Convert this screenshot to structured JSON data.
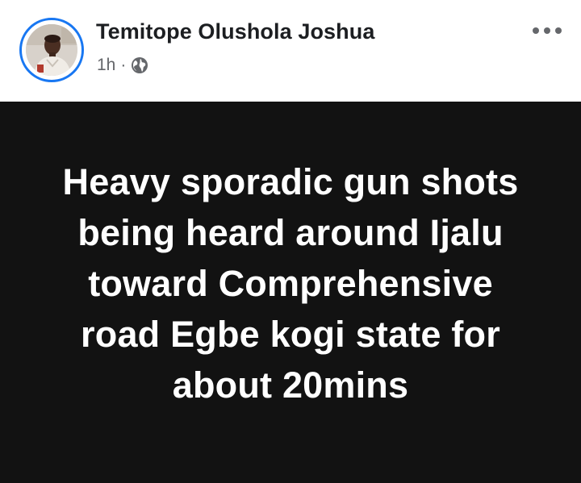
{
  "post": {
    "author": {
      "name": "Temitope Olushola Joshua",
      "avatar_icon": "profile-photo",
      "ring_color": "#1877f2"
    },
    "meta": {
      "time": "1h",
      "separator": "·",
      "audience_icon": "globe-icon"
    },
    "more_icon": "more-options-icon",
    "content": {
      "background_color": "#121212",
      "text_color": "#ffffff",
      "text": "Heavy sporadic gun shots being heard around Ijalu toward Comprehensive road Egbe kogi state for about 20mins"
    }
  }
}
